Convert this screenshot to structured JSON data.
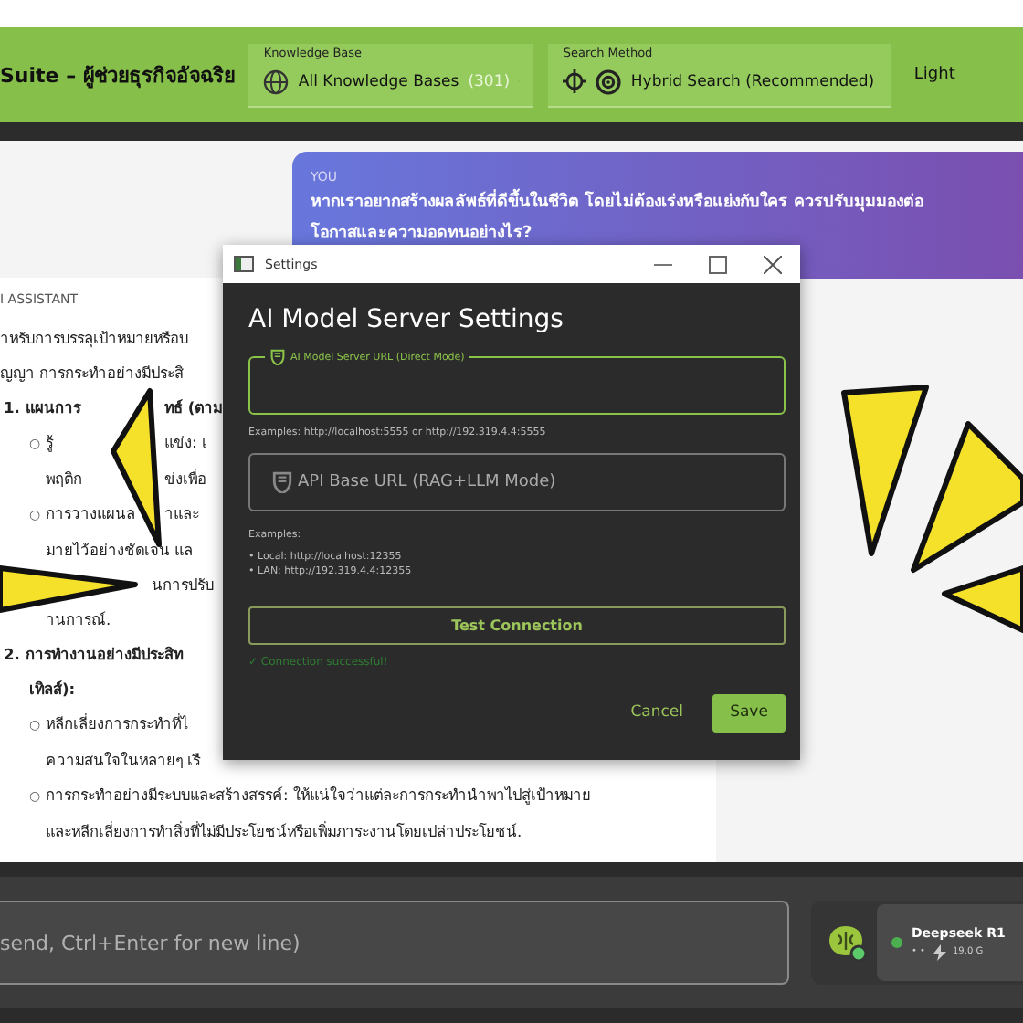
{
  "header": {
    "title": "Suite – ผู้ช่วยธุรกิจอัจฉริย",
    "knowledge_base": {
      "label": "Knowledge Base",
      "value": "All Knowledge Bases",
      "count": "(301)"
    },
    "search_method": {
      "label": "Search Method",
      "value": "Hybrid Search (Recommended)"
    },
    "theme": "Light"
  },
  "user_message": {
    "role": "YOU",
    "lines": [
      "หากเราอยากสร้างผลลัพธ์ที่ดีขึ้นในชีวิต โดยไม่ต้องเร่งหรือแย่งกับใคร ควรปรับมุมมองต่อ",
      "โอกาสและความอดทนอย่างไร?"
    ]
  },
  "assistant": {
    "label": "I ASSISTANT",
    "lines": [
      {
        "kind": "plain",
        "segments": [
          "าหรับการบรรลุเป้าหมายหรือบ"
        ]
      },
      {
        "kind": "plain",
        "segments": [
          "ญญา การกระทำอย่างมีประสิ"
        ]
      },
      {
        "kind": "heading",
        "segments": [
          "1. แผนการ",
          "ทธ์ (ตาม"
        ]
      },
      {
        "kind": "bullet",
        "marker": "○",
        "segments": [
          "รู้",
          "แข่ง: เ"
        ]
      },
      {
        "kind": "cont",
        "segments": [
          "พฤติก",
          "ข่งเพื่อ"
        ]
      },
      {
        "kind": "bullet",
        "marker": "○",
        "segments": [
          "การวางแผนล",
          "าและ"
        ]
      },
      {
        "kind": "cont",
        "segments": [
          "มายไว้อย่างชัดเจน แล"
        ]
      },
      {
        "kind": "tail",
        "segments": [
          "นการปรับ"
        ]
      },
      {
        "kind": "cont",
        "segments": [
          "านการณ์."
        ]
      },
      {
        "kind": "heading",
        "segments": [
          "2. การทำงานอย่างมีประสิท"
        ]
      },
      {
        "kind": "heading2",
        "segments": [
          "เทิลส์):"
        ]
      },
      {
        "kind": "bullet",
        "marker": "○",
        "segments": [
          "หลีกเลี่ยงการกระทำที่ไ"
        ]
      },
      {
        "kind": "cont",
        "segments": [
          "ความสนใจในหลายๆ เรื"
        ]
      },
      {
        "kind": "bullet",
        "marker": "○",
        "segments": [
          "การกระทำอย่างมีระบบและสร้างสรรค์: ให้แน่ใจว่าแต่ละการกระทำนำพาไปสู่เป้าหมาย"
        ]
      },
      {
        "kind": "cont",
        "segments": [
          "และหลีกเลี่ยงการทำสิ่งที่ไม่มีประโยชน์หรือเพิ่มภาระงานโดยเปล่าประโยชน์."
        ]
      }
    ]
  },
  "dialog": {
    "title": "Settings",
    "heading": "AI Model Server Settings",
    "fields": [
      {
        "label": "AI Model Server URL (Direct Mode)",
        "focused": true
      },
      {
        "label": "API Base URL (RAG+LLM Mode)",
        "focused": false
      }
    ],
    "hint": "Examples: http://localhost:5555 or http://192.319.4.4:5555",
    "examples": [
      "Examples:",
      "• Local: http://localhost:12355",
      "• LAN: http://192.319.4.4:12355"
    ],
    "test_button": "Test Connection",
    "status": "✓ Connection successful!",
    "cancel": "Cancel",
    "save": "Save"
  },
  "composer": {
    "placeholder": "send, Ctrl+Enter for new line)",
    "model": {
      "name": "Deepseek R1",
      "online": true,
      "dots": "• •",
      "size": "19.0 G"
    }
  }
}
